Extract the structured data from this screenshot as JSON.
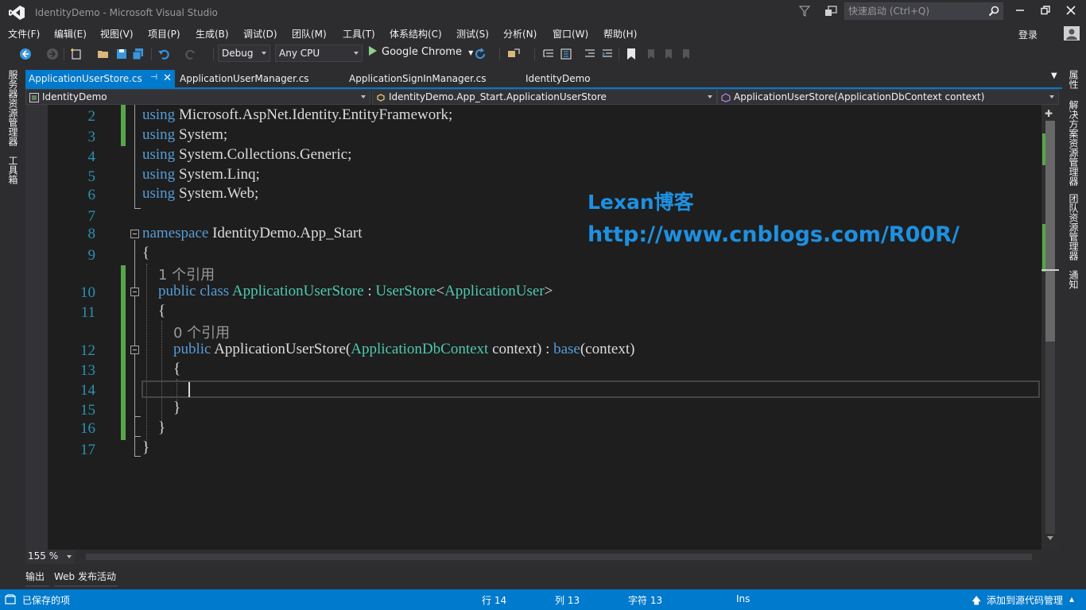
{
  "app": {
    "title": "IdentityDemo - Microsoft Visual Studio",
    "quick_launch_placeholder": "快速启动 (Ctrl+Q)",
    "login": "登录",
    "accent_color": "#007acc"
  },
  "menu": [
    "文件(F)",
    "编辑(E)",
    "视图(V)",
    "项目(P)",
    "生成(B)",
    "调试(D)",
    "团队(M)",
    "工具(T)",
    "体系结构(C)",
    "测试(S)",
    "分析(N)",
    "窗口(W)",
    "帮助(H)"
  ],
  "toolbar": {
    "configuration": "Debug",
    "platform": "Any CPU",
    "run_target": "Google Chrome"
  },
  "side_panels": {
    "left": [
      "服务器资源管理器",
      "工具箱"
    ],
    "right": [
      "属性",
      "解决方案资源管理器",
      "团队资源管理器",
      "通知"
    ]
  },
  "tabs": [
    {
      "label": "ApplicationUserStore.cs",
      "active": true
    },
    {
      "label": "ApplicationUserManager.cs",
      "active": false
    },
    {
      "label": "ApplicationSignInManager.cs",
      "active": false
    },
    {
      "label": "IdentityDemo",
      "active": false
    }
  ],
  "nav": {
    "project": "IdentityDemo",
    "type": "IdentityDemo.App_Start.ApplicationUserStore",
    "member": "ApplicationUserStore(ApplicationDbContext context)"
  },
  "code": {
    "line_numbers": [
      "2",
      "3",
      "4",
      "5",
      "6",
      "7",
      "8",
      "9",
      "10",
      "11",
      "12",
      "13",
      "14",
      "15",
      "16",
      "17"
    ],
    "lines": {
      "l2": {
        "kw": "using",
        "rest": " Microsoft.AspNet.Identity.EntityFramework;"
      },
      "l3": {
        "kw": "using",
        "rest": " System;"
      },
      "l4": {
        "kw": "using",
        "rest": " System.Collections.Generic;"
      },
      "l5": {
        "kw": "using",
        "rest": " System.Linq;"
      },
      "l6": {
        "kw": "using",
        "rest": " System.Web;"
      },
      "l8": {
        "kw": "namespace",
        "rest": " IdentityDemo.App_Start"
      },
      "l9": "{",
      "lens1": "1 个引用",
      "l10": {
        "kw1": "public",
        "kw2": "class",
        "type1": "ApplicationUserStore",
        "sep": " : ",
        "type2": "UserStore",
        "lt": "<",
        "type3": "ApplicationUser",
        "gt": ">"
      },
      "l11": "{",
      "lens2": "0 个引用",
      "l12": {
        "kw1": "public",
        "name": " ApplicationUserStore(",
        "type1": "ApplicationDbContext",
        "mid": " context) : ",
        "kw2": "base",
        "end": "(context)"
      },
      "l13": "{",
      "l15": "}",
      "l16": "}",
      "l17": "}"
    }
  },
  "watermark": {
    "line1": "Lexan博客",
    "line2": "http://www.cnblogs.com/R00R/"
  },
  "zoom": "155 %",
  "bottom_tabs": [
    "输出",
    "Web 发布活动"
  ],
  "status": {
    "saved": "已保存的项",
    "line": "行 14",
    "col": "列 13",
    "char": "字符 13",
    "mode": "Ins",
    "source_control": "添加到源代码管理"
  }
}
